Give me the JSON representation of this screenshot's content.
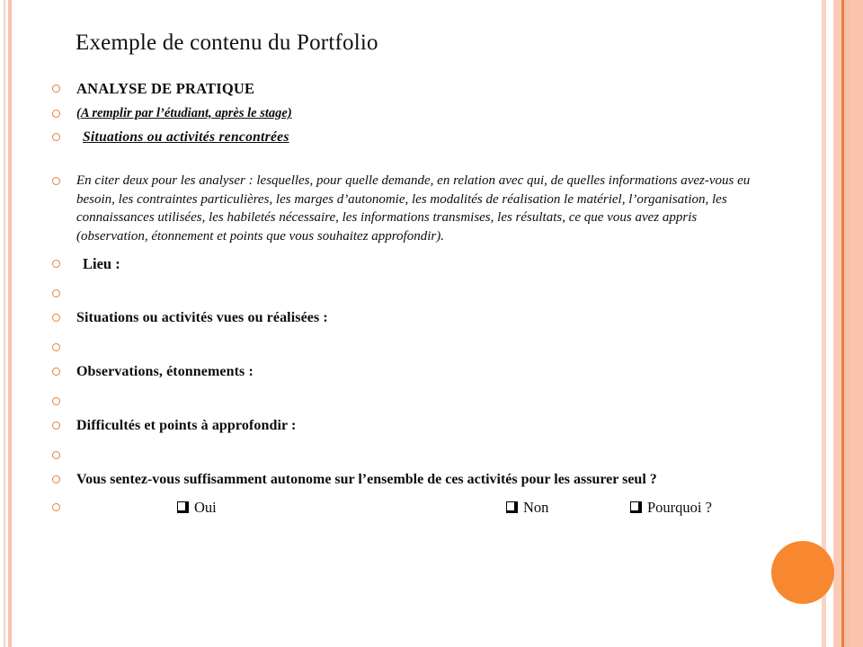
{
  "slide": {
    "title": "Exemple de contenu du Portfolio",
    "background_color": "#ffffff",
    "accent_color": "#f7882f",
    "bullet_color": "#e2813f",
    "edge_color": "#fbc3ad"
  },
  "content": {
    "heading": "ANALYSE DE PRATIQUE",
    "subheading_note": "(A remplir par l’étudiant, après le stage)",
    "section_title": "Situations ou activités rencontrées",
    "instruction_paragraph": "En citer deux pour les analyser : lesquelles,  pour quelle demande, en  relation avec qui, de quelles informations avez-vous eu besoin,  les contraintes particulières, les marges d’autonomie, les modalités de réalisation le matériel, l’organisation,  les connaissances utilisées, les habiletés nécessaire, les informations transmises, les résultats, ce que vous avez appris (observation, étonnement et points que vous souhaitez approfondir).",
    "field_lieu": "Lieu :",
    "field_situations": "Situations ou activités vues ou réalisées :",
    "field_observations": "Observations, étonnements :",
    "field_difficultes": "Difficultés  et points à approfondir :",
    "question": "Vous sentez-vous suffisamment autonome sur l’ensemble de ces activités pour les assurer seul ?",
    "options": {
      "oui": "Oui",
      "non": "Non",
      "pourquoi": "Pourquoi ?"
    }
  }
}
